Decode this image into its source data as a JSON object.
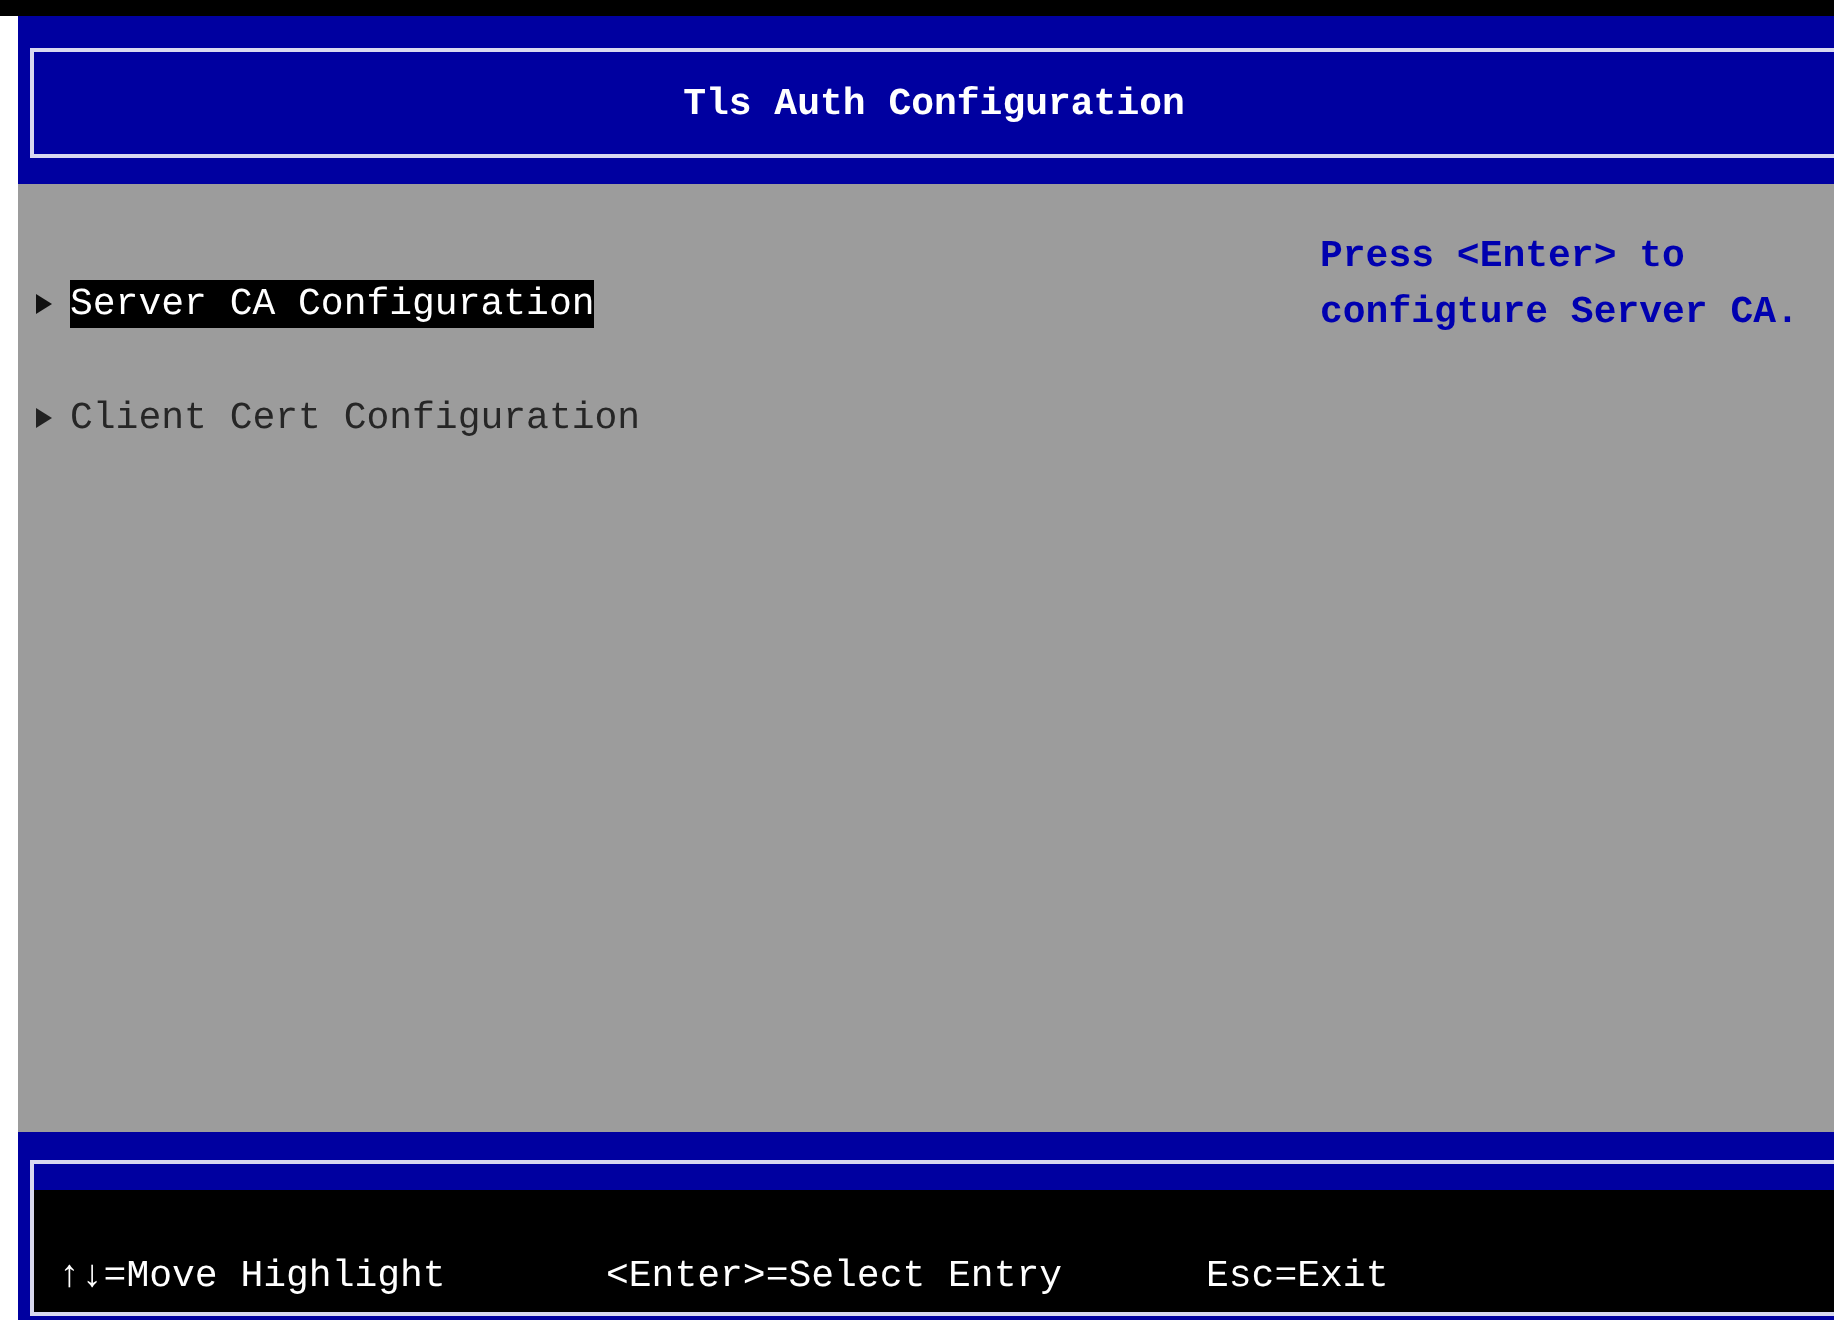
{
  "window": {
    "title": "Tls Auth Configuration"
  },
  "menu": {
    "items": [
      {
        "label": "Server CA Configuration",
        "selected": true
      },
      {
        "label": "Client Cert Configuration",
        "selected": false
      }
    ]
  },
  "help_text": "Press <Enter> to\nconfigture Server CA.",
  "status_bar": {
    "hints": [
      "↑↓=Move Highlight",
      "<Enter>=Select Entry",
      "Esc=Exit"
    ]
  }
}
